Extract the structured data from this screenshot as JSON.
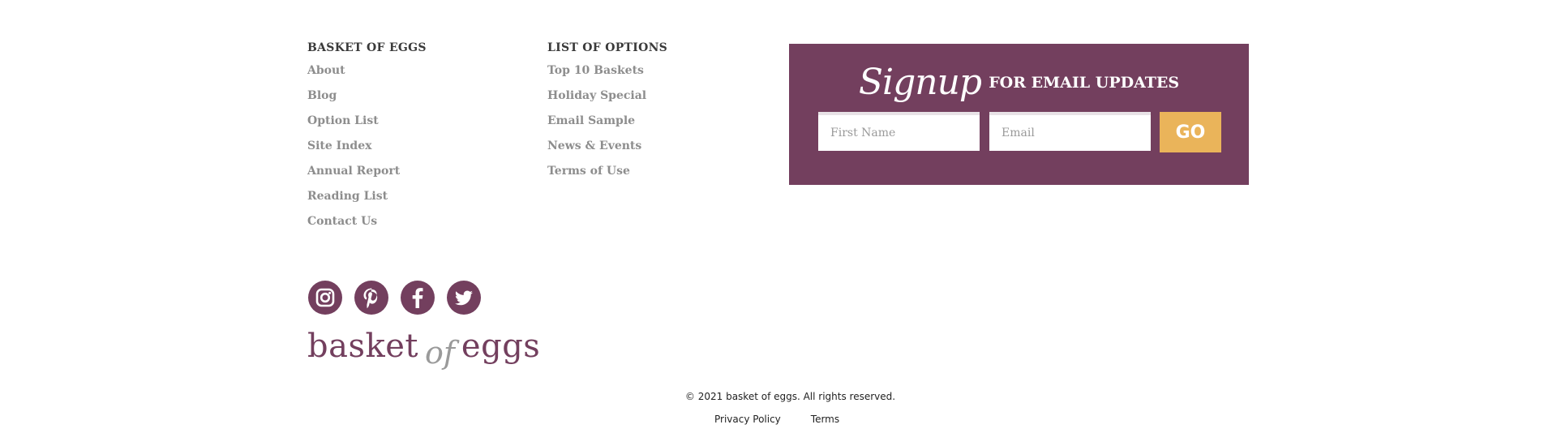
{
  "columns": [
    {
      "heading": "BASKET OF EGGS",
      "links": [
        "About",
        "Blog",
        "Option List",
        "Site Index",
        "Annual Report",
        "Reading List",
        "Contact Us"
      ]
    },
    {
      "heading": "LIST OF OPTIONS",
      "links": [
        "Top 10 Baskets",
        "Holiday Special",
        "Email Sample",
        "News & Events",
        "Terms of Use"
      ]
    }
  ],
  "signup": {
    "script_text": "Signup",
    "title_text": "FOR EMAIL UPDATES",
    "first_name_placeholder": "First Name",
    "email_placeholder": "Email",
    "button_label": "GO"
  },
  "social": [
    "instagram-icon",
    "pinterest-icon",
    "facebook-icon",
    "twitter-icon"
  ],
  "logo": {
    "word1": "basket",
    "word2": "of",
    "word3": "eggs"
  },
  "copyright": "© 2021 basket of eggs. All rights reserved.",
  "legal_links": [
    "Privacy Policy",
    "Terms"
  ],
  "colors": {
    "brand_plum": "#733f5e",
    "accent_gold": "#eab45a",
    "link_gray": "#8d8d8d"
  }
}
